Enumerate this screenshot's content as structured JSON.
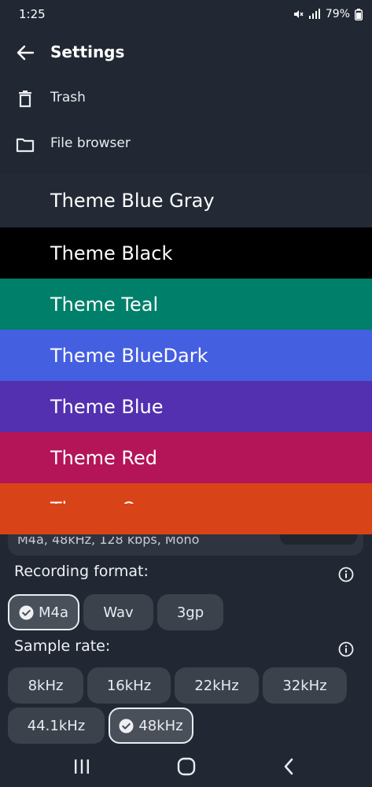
{
  "status_bar": {
    "time": "1:25",
    "battery": "79%"
  },
  "header": {
    "title": "Settings",
    "back_icon": "arrow-left-icon"
  },
  "menu": [
    {
      "label": "Trash",
      "icon": "trash-icon"
    },
    {
      "label": "File browser",
      "icon": "folder-icon"
    }
  ],
  "themes": [
    {
      "label": "Theme Blue Gray",
      "color": "#232a36"
    },
    {
      "label": "Theme Black",
      "color": "#000000"
    },
    {
      "label": "Theme Teal",
      "color": "#00806a"
    },
    {
      "label": "Theme BlueDark",
      "color": "#445fe0"
    },
    {
      "label": "Theme Blue",
      "color": "#5230b0"
    },
    {
      "label": "Theme Red",
      "color": "#b41458"
    },
    {
      "label": "Theme Orange",
      "color": "#d84418"
    }
  ],
  "summary": {
    "text": "M4a, 48kHz, 128 kbps, Mono"
  },
  "recording_format": {
    "label": "Recording format:",
    "options": [
      "M4a",
      "Wav",
      "3gp"
    ],
    "selected": "M4a"
  },
  "sample_rate": {
    "label": "Sample rate:",
    "options": [
      "8kHz",
      "16kHz",
      "22kHz",
      "32kHz",
      "44.1kHz",
      "48kHz"
    ],
    "selected": "48kHz"
  },
  "colors": {
    "background": "#222833",
    "chip": "#3c424c",
    "text": "#eef0f4"
  }
}
